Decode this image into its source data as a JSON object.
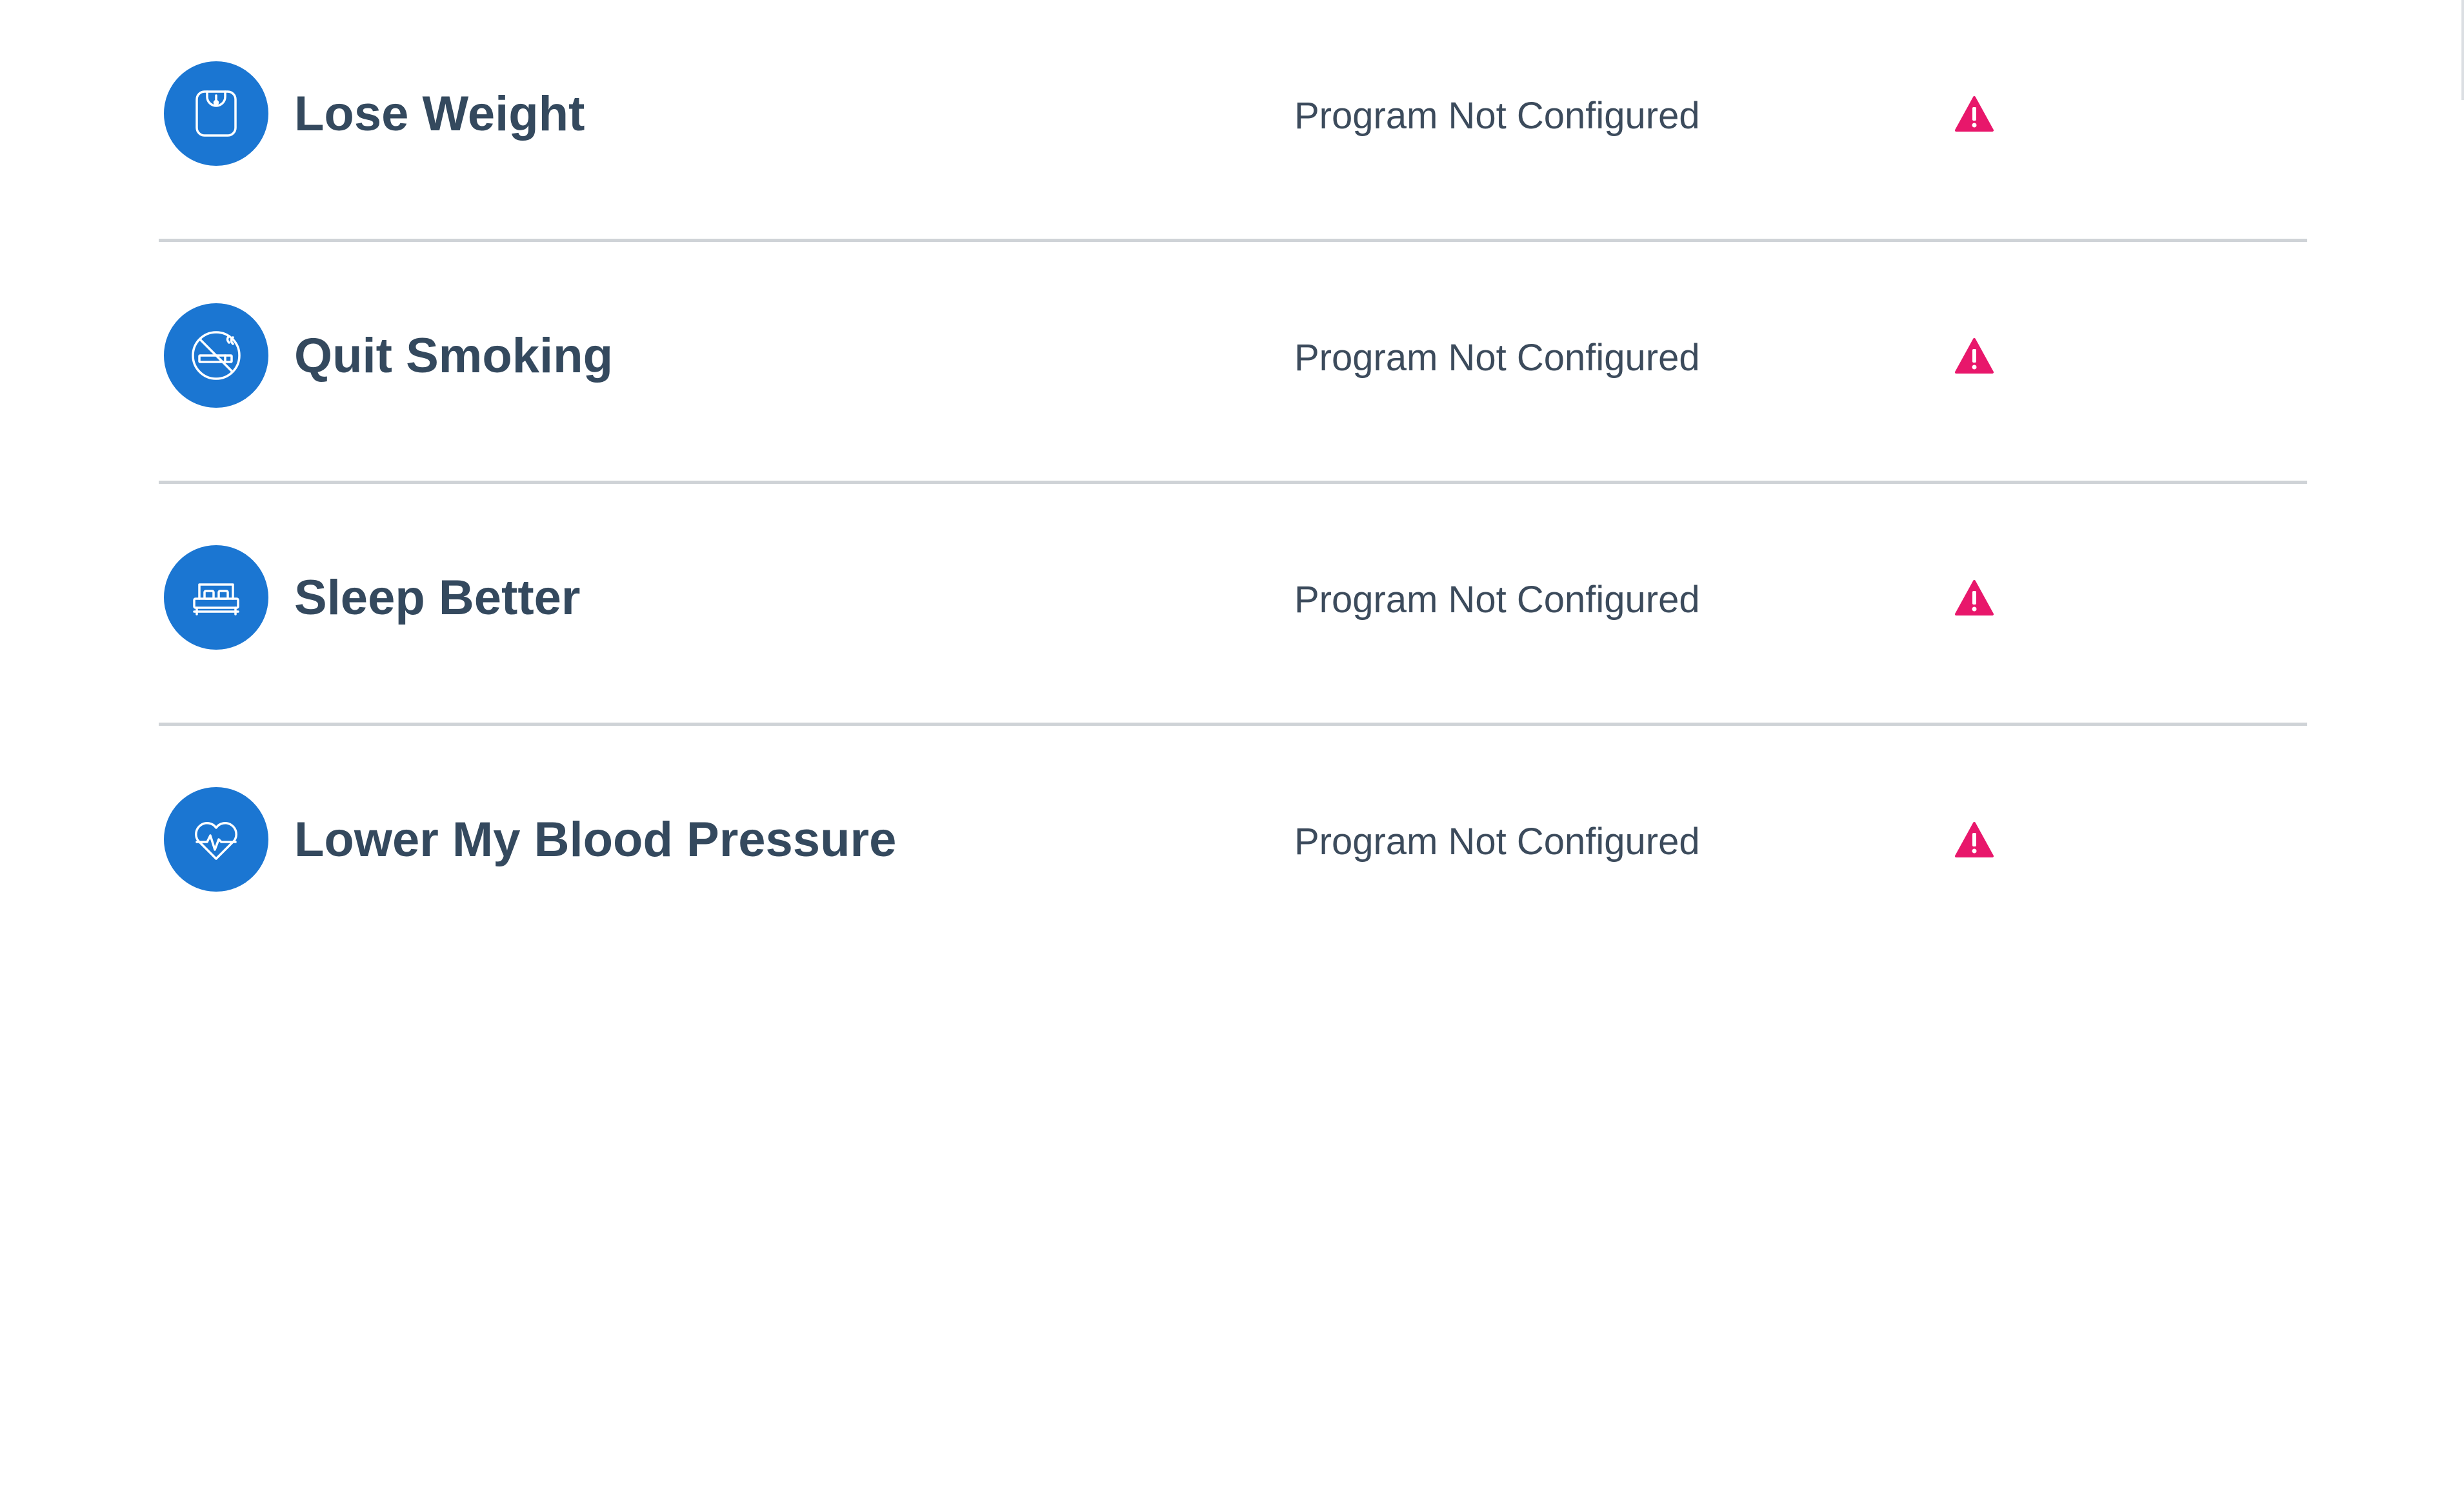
{
  "colors": {
    "accent": "#1b76d2",
    "warning": "#e8176b",
    "title_text": "#34495e",
    "status_text": "#3c4b5c",
    "divider": "#cfd3d7"
  },
  "programs": [
    {
      "name": "Lose Weight",
      "icon": "scale-icon",
      "status": "Program Not Configured",
      "status_icon": "warning-icon"
    },
    {
      "name": "Quit Smoking",
      "icon": "no-smoking-icon",
      "status": "Program Not Configured",
      "status_icon": "warning-icon"
    },
    {
      "name": "Sleep Better",
      "icon": "bed-icon",
      "status": "Program Not Configured",
      "status_icon": "warning-icon"
    },
    {
      "name": "Lower My Blood Pressure",
      "icon": "heart-pulse-icon",
      "status": "Program Not Configured",
      "status_icon": "warning-icon"
    }
  ]
}
